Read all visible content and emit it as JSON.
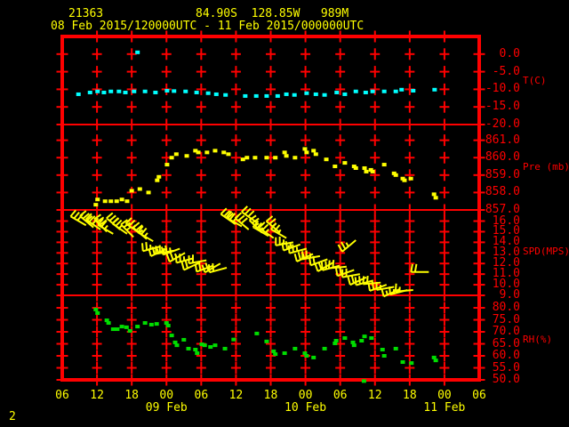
{
  "header": {
    "station_id": "21363",
    "location": "84.90S  128.85W   989M",
    "time_range": "08 Feb 2015/120000UTC - 11 Feb 2015/000000UTC"
  },
  "footer": {
    "page_number": "2"
  },
  "colors": {
    "background": "#000000",
    "grid": "#ff0000",
    "axis_text": "#ff0000",
    "header_text": "#ffff00",
    "temperature": "#00ffff",
    "pressure": "#ffff00",
    "wind": "#ffff00",
    "humidity": "#00dd00"
  },
  "chart_data": {
    "type": "scatter",
    "title": "",
    "x_axis": {
      "tick_labels": [
        "06",
        "12",
        "18",
        "00",
        "06",
        "12",
        "18",
        "00",
        "06",
        "12",
        "18",
        "00",
        "06"
      ],
      "tick_hours": [
        6,
        12,
        18,
        24,
        30,
        36,
        42,
        48,
        54,
        60,
        66,
        72,
        78
      ],
      "date_labels": [
        {
          "label": "09 Feb",
          "hour": 24
        },
        {
          "label": "10 Feb",
          "hour": 48
        },
        {
          "label": "11 Feb",
          "hour": 72
        }
      ],
      "hour_range": [
        6,
        78
      ],
      "note_hours_since": "08 Feb 2015 00UTC"
    },
    "panels": [
      {
        "name": "temperature",
        "axis_title": "T(C)",
        "marker": "square",
        "tick_labels": [
          "0.0",
          "-5.0",
          "-10.0",
          "-15.0",
          "-20.0"
        ],
        "tick_values": [
          0,
          -5,
          -10,
          -15,
          -20
        ],
        "value_range": [
          5.0,
          -20.0
        ],
        "points": [
          [
            8.8,
            -11.4
          ],
          [
            10.8,
            -10.9
          ],
          [
            12.1,
            -10.6
          ],
          [
            13.2,
            -10.9
          ],
          [
            14.4,
            -10.6
          ],
          [
            15.8,
            -10.6
          ],
          [
            16.9,
            -10.9
          ],
          [
            18.4,
            -10.6
          ],
          [
            19.0,
            0.5
          ],
          [
            20.3,
            -10.6
          ],
          [
            22.1,
            -10.9
          ],
          [
            24.1,
            -10.4
          ],
          [
            25.3,
            -10.5
          ],
          [
            27.3,
            -10.6
          ],
          [
            29.2,
            -10.9
          ],
          [
            31.2,
            -11.1
          ],
          [
            32.6,
            -11.4
          ],
          [
            34.2,
            -11.6
          ],
          [
            37.6,
            -11.9
          ],
          [
            39.5,
            -11.9
          ],
          [
            41.3,
            -11.9
          ],
          [
            43.2,
            -11.9
          ],
          [
            44.7,
            -11.4
          ],
          [
            46.1,
            -11.6
          ],
          [
            48.2,
            -11.1
          ],
          [
            49.8,
            -11.4
          ],
          [
            51.3,
            -11.6
          ],
          [
            53.4,
            -10.9
          ],
          [
            54.8,
            -11.4
          ],
          [
            56.7,
            -10.6
          ],
          [
            58.4,
            -10.9
          ],
          [
            59.6,
            -10.6
          ],
          [
            61.6,
            -10.6
          ],
          [
            63.6,
            -10.6
          ],
          [
            64.6,
            -10.1
          ],
          [
            66.6,
            -10.4
          ],
          [
            70.3,
            -10.1
          ]
        ]
      },
      {
        "name": "pressure",
        "axis_title": "Pre (mb)",
        "marker": "square",
        "tick_labels": [
          "861.0",
          "860.0",
          "859.0",
          "858.0",
          "857.0"
        ],
        "tick_values": [
          861,
          860,
          859,
          858,
          857
        ],
        "value_range": [
          861.9,
          857.0
        ],
        "points": [
          [
            11.8,
            857.3
          ],
          [
            12.1,
            857.6
          ],
          [
            13.4,
            857.5
          ],
          [
            14.4,
            857.5
          ],
          [
            15.4,
            857.5
          ],
          [
            16.3,
            857.6
          ],
          [
            17.2,
            857.5
          ],
          [
            18.0,
            858.1
          ],
          [
            19.4,
            858.2
          ],
          [
            20.9,
            858.0
          ],
          [
            22.4,
            858.7
          ],
          [
            22.7,
            858.9
          ],
          [
            24.1,
            859.6
          ],
          [
            24.9,
            860.0
          ],
          [
            25.7,
            860.2
          ],
          [
            27.5,
            860.1
          ],
          [
            29.0,
            860.4
          ],
          [
            29.5,
            860.3
          ],
          [
            31.0,
            860.3
          ],
          [
            32.4,
            860.4
          ],
          [
            33.9,
            860.3
          ],
          [
            34.7,
            860.2
          ],
          [
            37.2,
            859.9
          ],
          [
            37.9,
            860.0
          ],
          [
            39.3,
            860.0
          ],
          [
            41.3,
            860.0
          ],
          [
            42.8,
            860.0
          ],
          [
            44.4,
            860.3
          ],
          [
            44.7,
            860.1
          ],
          [
            46.2,
            860.0
          ],
          [
            47.9,
            860.5
          ],
          [
            48.2,
            860.3
          ],
          [
            49.4,
            860.4
          ],
          [
            49.8,
            860.2
          ],
          [
            51.6,
            859.9
          ],
          [
            53.1,
            859.5
          ],
          [
            54.8,
            859.7
          ],
          [
            56.4,
            859.5
          ],
          [
            56.7,
            859.4
          ],
          [
            58.2,
            859.4
          ],
          [
            58.5,
            859.2
          ],
          [
            59.3,
            859.3
          ],
          [
            59.6,
            859.2
          ],
          [
            61.6,
            859.6
          ],
          [
            63.3,
            859.1
          ],
          [
            63.6,
            859.0
          ],
          [
            64.8,
            858.8
          ],
          [
            65.1,
            858.7
          ],
          [
            66.2,
            858.8
          ],
          [
            70.2,
            857.9
          ],
          [
            70.5,
            857.7
          ]
        ]
      },
      {
        "name": "wind_speed",
        "axis_title": "SPD(MPS)",
        "marker": "wind_barb",
        "tick_labels": [
          "16.0",
          "15.0",
          "14.0",
          "13.0",
          "12.0",
          "11.0",
          "10.0",
          "9.0"
        ],
        "tick_values": [
          16,
          15,
          14,
          13,
          12,
          11,
          10,
          9
        ],
        "value_range": [
          17.05,
          9.0
        ],
        "points": [
          [
            10.1,
            15.6,
            -150
          ],
          [
            11.4,
            15.4,
            -140
          ],
          [
            12.6,
            15.2,
            -145
          ],
          [
            13.7,
            15.0,
            -135
          ],
          [
            14.8,
            14.8,
            -150
          ],
          [
            16.0,
            15.2,
            -140
          ],
          [
            17.2,
            14.8,
            -145
          ],
          [
            18.3,
            14.5,
            -135
          ],
          [
            19.5,
            14.8,
            -145
          ],
          [
            20.6,
            14.3,
            -140
          ],
          [
            21.7,
            14.1,
            -150
          ],
          [
            22.9,
            13.6,
            165
          ],
          [
            24.1,
            13.4,
            155
          ],
          [
            25.2,
            13.2,
            170
          ],
          [
            26.3,
            13.4,
            160
          ],
          [
            27.2,
            13.0,
            150
          ],
          [
            28.7,
            12.5,
            165
          ],
          [
            29.8,
            12.1,
            155
          ],
          [
            30.9,
            12.3,
            170
          ],
          [
            32.1,
            11.8,
            160
          ],
          [
            33.3,
            12.0,
            150
          ],
          [
            34.4,
            11.6,
            165
          ],
          [
            35.9,
            15.7,
            -145
          ],
          [
            37.0,
            15.5,
            -150
          ],
          [
            38.2,
            15.2,
            -140
          ],
          [
            39.5,
            15.9,
            -145
          ],
          [
            40.5,
            14.9,
            -135
          ],
          [
            41.6,
            14.6,
            -150
          ],
          [
            42.5,
            14.4,
            -145
          ],
          [
            43.6,
            14.9,
            -140
          ],
          [
            44.7,
            14.4,
            -150
          ],
          [
            45.9,
            14.0,
            170
          ],
          [
            47.1,
            13.8,
            160
          ],
          [
            48.2,
            13.4,
            165
          ],
          [
            49.3,
            12.9,
            155
          ],
          [
            50.5,
            12.7,
            170
          ],
          [
            51.8,
            12.4,
            160
          ],
          [
            52.8,
            12.1,
            150
          ],
          [
            53.9,
            11.8,
            165
          ],
          [
            55.1,
            11.7,
            175
          ],
          [
            56.4,
            11.4,
            160
          ],
          [
            56.7,
            14.2,
            140
          ],
          [
            57.4,
            11.0,
            170
          ],
          [
            58.5,
            10.7,
            155
          ],
          [
            59.7,
            10.4,
            165
          ],
          [
            61.0,
            10.2,
            175
          ],
          [
            62.0,
            10.0,
            160
          ],
          [
            63.3,
            9.8,
            170
          ],
          [
            64.3,
            9.6,
            155
          ],
          [
            65.6,
            9.5,
            165
          ],
          [
            66.6,
            9.5,
            175
          ],
          [
            69.3,
            11.2,
            180
          ]
        ]
      },
      {
        "name": "relative_humidity",
        "axis_title": "RH(%)",
        "marker": "square",
        "tick_labels": [
          "80.0",
          "75.0",
          "70.0",
          "65.0",
          "60.0",
          "55.0",
          "50.0"
        ],
        "tick_values": [
          80,
          75,
          70,
          65,
          60,
          55,
          50
        ],
        "value_range": [
          85.2,
          50.0
        ],
        "points": [
          [
            11.8,
            79.3
          ],
          [
            12.1,
            77.8
          ],
          [
            13.7,
            74.8
          ],
          [
            14.0,
            73.7
          ],
          [
            14.8,
            71.1
          ],
          [
            15.5,
            71.1
          ],
          [
            16.3,
            72.2
          ],
          [
            17.1,
            71.9
          ],
          [
            17.7,
            70.4
          ],
          [
            19.0,
            72.2
          ],
          [
            20.3,
            73.7
          ],
          [
            21.4,
            73.0
          ],
          [
            22.3,
            73.3
          ],
          [
            24.0,
            73.7
          ],
          [
            24.3,
            72.6
          ],
          [
            24.9,
            68.5
          ],
          [
            25.5,
            65.6
          ],
          [
            25.8,
            64.4
          ],
          [
            27.0,
            66.7
          ],
          [
            27.8,
            63.0
          ],
          [
            29.0,
            62.6
          ],
          [
            29.3,
            61.1
          ],
          [
            30.1,
            64.8
          ],
          [
            30.6,
            64.4
          ],
          [
            31.6,
            63.7
          ],
          [
            32.4,
            64.4
          ],
          [
            34.1,
            63.0
          ],
          [
            35.6,
            66.8
          ],
          [
            39.6,
            69.3
          ],
          [
            41.3,
            66.0
          ],
          [
            42.5,
            61.9
          ],
          [
            42.8,
            60.7
          ],
          [
            44.4,
            61.1
          ],
          [
            46.2,
            63.0
          ],
          [
            47.9,
            61.1
          ],
          [
            48.2,
            60.0
          ],
          [
            49.4,
            59.3
          ],
          [
            51.3,
            63.0
          ],
          [
            53.1,
            65.2
          ],
          [
            53.3,
            66.3
          ],
          [
            54.8,
            67.4
          ],
          [
            56.2,
            65.6
          ],
          [
            56.4,
            64.4
          ],
          [
            57.7,
            66.3
          ],
          [
            58.1,
            49.5
          ],
          [
            58.2,
            68.1
          ],
          [
            59.4,
            67.4
          ],
          [
            61.3,
            62.6
          ],
          [
            61.6,
            60.0
          ],
          [
            63.6,
            63.0
          ],
          [
            64.8,
            57.4
          ],
          [
            66.3,
            57.0
          ],
          [
            70.2,
            59.3
          ],
          [
            70.5,
            58.1
          ]
        ]
      }
    ]
  }
}
